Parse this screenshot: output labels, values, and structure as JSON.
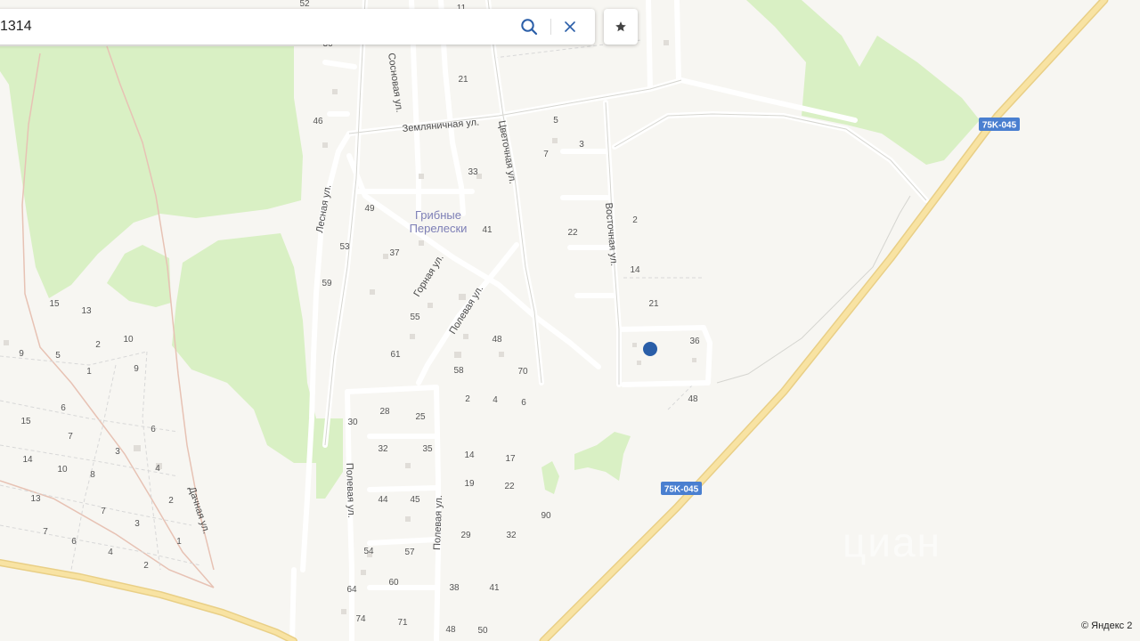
{
  "search": {
    "value": "1314"
  },
  "icons": {
    "search": "search-icon",
    "clear": "close-icon",
    "favorite": "star-icon",
    "marker": "location-dot-icon"
  },
  "colors": {
    "forest": "#d9f0c4",
    "road_major": "#f6dc8c",
    "road_minor": "#ffffff",
    "marker": "#2a5ea8",
    "label": "#4a4a4a",
    "place": "#7d7fb6",
    "route_badge": "#4a7fd0"
  },
  "streets": {
    "sosnovaya": "Сосновая ул.",
    "zemlyanichnaya": "Земляничная ул.",
    "tsvetochnaya": "Цветочная ул.",
    "lesnaya": "Лесная ул.",
    "vostochnaya": "Восточная ул.",
    "gornaya": "Горная ул.",
    "polevaya": "Полевая ул.",
    "polevaya_2": "Полевая ул.",
    "polevaya_3": "Полевая ул.",
    "dachnaya": "Дачная ул."
  },
  "place": {
    "line1": "Грибные",
    "line2": "Перелески"
  },
  "routes": {
    "r1": "75K-045",
    "r2": "75K-045"
  },
  "house_numbers": [
    "52",
    "11",
    "36",
    "21",
    "46",
    "5",
    "3",
    "7",
    "33",
    "49",
    "41",
    "22",
    "2",
    "53",
    "37",
    "14",
    "59",
    "21",
    "15",
    "13",
    "55",
    "36",
    "10",
    "2",
    "9",
    "5",
    "1",
    "9",
    "61",
    "48",
    "58",
    "70",
    "48",
    "6",
    "2",
    "4",
    "6",
    "15",
    "28",
    "25",
    "7",
    "6",
    "30",
    "3",
    "14",
    "10",
    "8",
    "4",
    "32",
    "35",
    "14",
    "17",
    "13",
    "2",
    "19",
    "22",
    "7",
    "3",
    "44",
    "45",
    "90",
    "7",
    "6",
    "4",
    "2",
    "1",
    "54",
    "57",
    "29",
    "32",
    "60",
    "64",
    "38",
    "41",
    "74",
    "71",
    "48",
    "50"
  ],
  "copyright": "© Яндекс 2",
  "watermark": "циан"
}
